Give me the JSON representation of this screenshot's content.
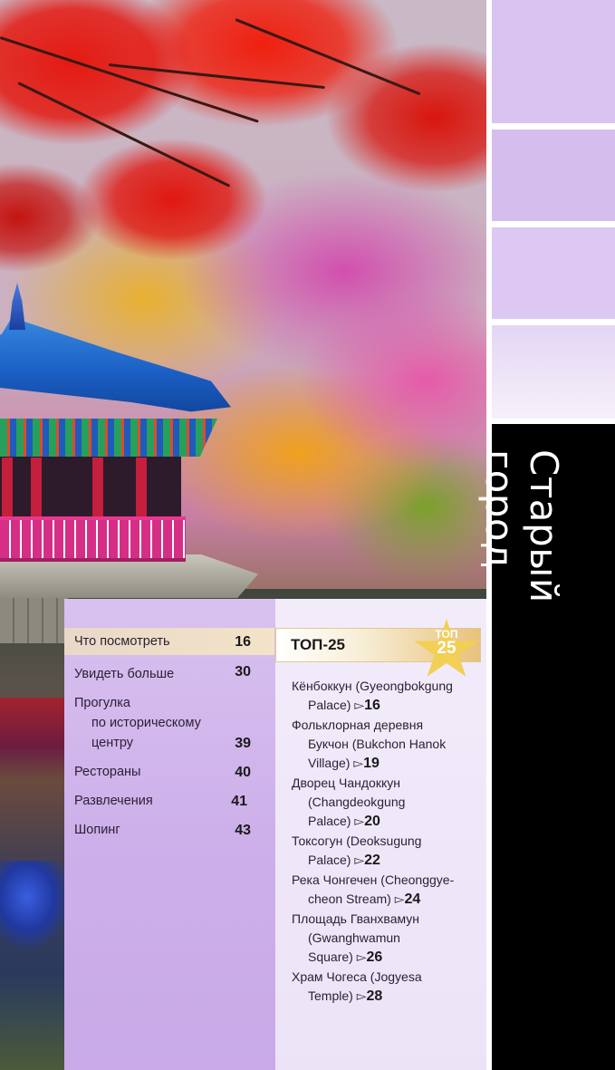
{
  "side_title": "Старый город",
  "toc": [
    {
      "label": "Что посмотреть",
      "page": "16"
    },
    {
      "label": "Увидеть больше",
      "page": "30"
    },
    {
      "label": "Прогулка по историческому центру",
      "line1": "Прогулка",
      "line2": "по историческому",
      "line3": "центру",
      "page": "39"
    },
    {
      "label": "Рестораны",
      "page": "40"
    },
    {
      "label": "Развлечения",
      "page": "41"
    },
    {
      "label": "Шопинг",
      "page": "43"
    }
  ],
  "top": {
    "heading": "ТОП-25",
    "badge_line1": "ТОП",
    "badge_line2": "25",
    "arrow": "▻",
    "items": [
      {
        "ru": "Кёнбоккун (Gyeongbokgung",
        "cont": "Palace)",
        "page": "16"
      },
      {
        "ru": "Фольклорная деревня",
        "cont": "Букчон (Bukchon Hanok",
        "cont2": "Village)",
        "page": "19"
      },
      {
        "ru": "Дворец Чандоккун",
        "cont": "(Changdeokgung",
        "cont2": "Palace)",
        "page": "20"
      },
      {
        "ru": "Токсогун (Deoksugung",
        "cont": "Palace)",
        "page": "22"
      },
      {
        "ru": "Река Чонгечен (Cheonggye-",
        "cont": "cheon Stream)",
        "page": "24"
      },
      {
        "ru": "Площадь Гванхвамун",
        "cont": "(Gwanghwamun",
        "cont2": "Square)",
        "page": "26"
      },
      {
        "ru": "Храм Чогеса (Jogyesa",
        "cont": "Temple)",
        "page": "28"
      }
    ]
  }
}
